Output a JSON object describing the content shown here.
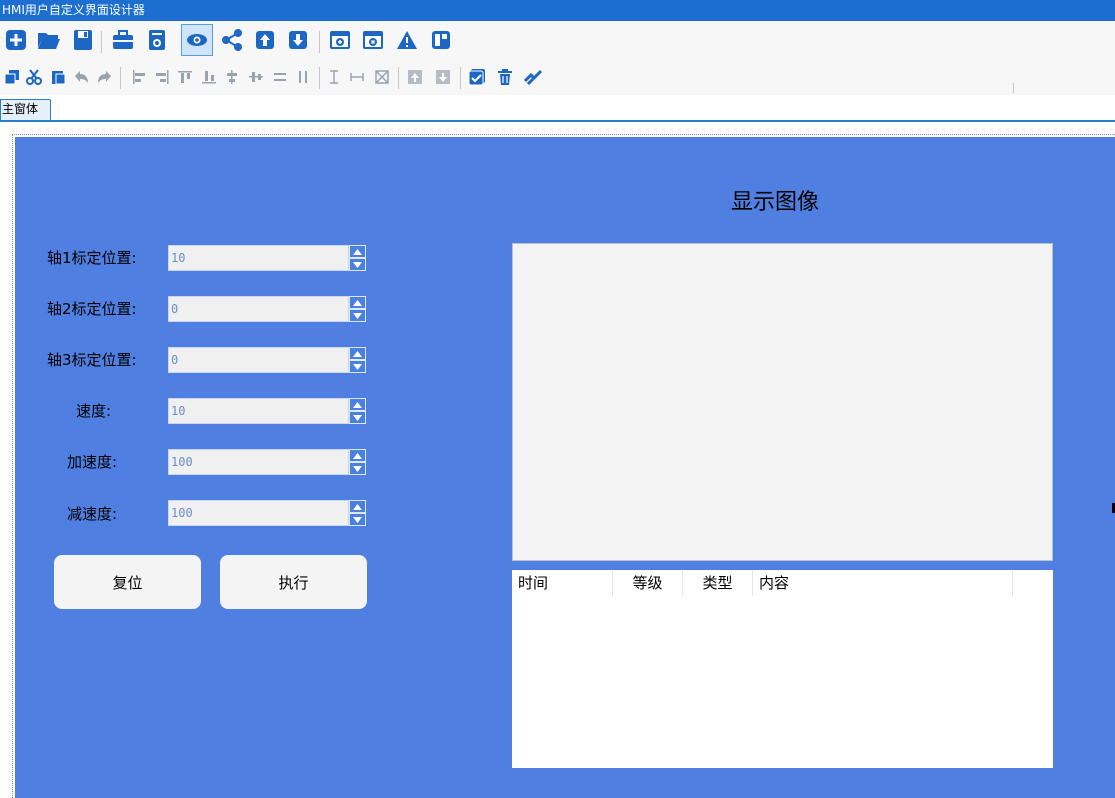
{
  "window": {
    "title": "HMI用户自定义界面设计器"
  },
  "toolbar1": {
    "icons": [
      "new-icon",
      "open-folder-icon",
      "save-icon",
      "toolbox-icon",
      "properties-icon",
      "preview-eye-icon",
      "share-icon",
      "upload-icon",
      "download-icon",
      "window-add-icon",
      "window-close-icon",
      "warning-icon",
      "layout-icon"
    ]
  },
  "toolbar2": {
    "icons": [
      "copy-icon",
      "cut-icon",
      "paste-icon",
      "undo-icon",
      "redo-icon",
      "align-left-icon",
      "align-right-icon",
      "align-top-icon",
      "align-bottom-icon",
      "align-center-v-icon",
      "align-center-h-icon",
      "distribute-h-icon",
      "distribute-v-icon",
      "same-height-icon",
      "same-width-icon",
      "same-size-icon",
      "bring-front-icon",
      "send-back-icon",
      "select-all-icon",
      "delete-icon",
      "run-icon"
    ]
  },
  "tabs": [
    {
      "label": "主窗体"
    }
  ],
  "form": {
    "background": "#4f7fe0",
    "fields": [
      {
        "label": "轴1标定位置:",
        "value": "10"
      },
      {
        "label": "轴2标定位置:",
        "value": "0"
      },
      {
        "label": "轴3标定位置:",
        "value": "0"
      },
      {
        "label": "速度:",
        "value": "10"
      },
      {
        "label": "加速度:",
        "value": "100"
      },
      {
        "label": "减速度:",
        "value": "100"
      }
    ],
    "buttons": {
      "reset": "复位",
      "execute": "执行"
    },
    "image_title": "显示图像",
    "log_table": {
      "columns": [
        "时间",
        "等级",
        "类型",
        "内容"
      ]
    }
  }
}
